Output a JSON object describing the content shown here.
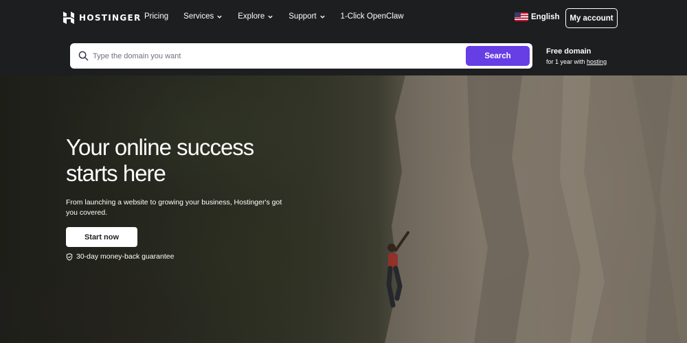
{
  "brand": {
    "name": "HOSTINGER"
  },
  "nav": {
    "items": [
      {
        "label": "Pricing",
        "dropdown": false
      },
      {
        "label": "Services",
        "dropdown": true
      },
      {
        "label": "Explore",
        "dropdown": true
      },
      {
        "label": "Support",
        "dropdown": true
      },
      {
        "label": "1-Click OpenClaw",
        "dropdown": false
      }
    ],
    "language": "English",
    "account_label": "My account"
  },
  "search": {
    "placeholder": "Type the domain you want",
    "value": "",
    "button_label": "Search"
  },
  "promo": {
    "title": "Free domain",
    "subtitle_prefix": "for 1 year with",
    "subtitle_link": "hosting"
  },
  "hero": {
    "title": "Your online success starts here",
    "subtitle": "From launching a website to growing your business, Hostinger's got you covered.",
    "cta_label": "Start now",
    "guarantee": "30-day money-back guarantee"
  },
  "colors": {
    "header_bg": "#1d1e20",
    "accent": "#673de6",
    "text": "#ffffff"
  },
  "icons": [
    "hostinger-logo-icon",
    "chevron-down-icon",
    "us-flag-icon",
    "search-icon",
    "shield-icon"
  ]
}
